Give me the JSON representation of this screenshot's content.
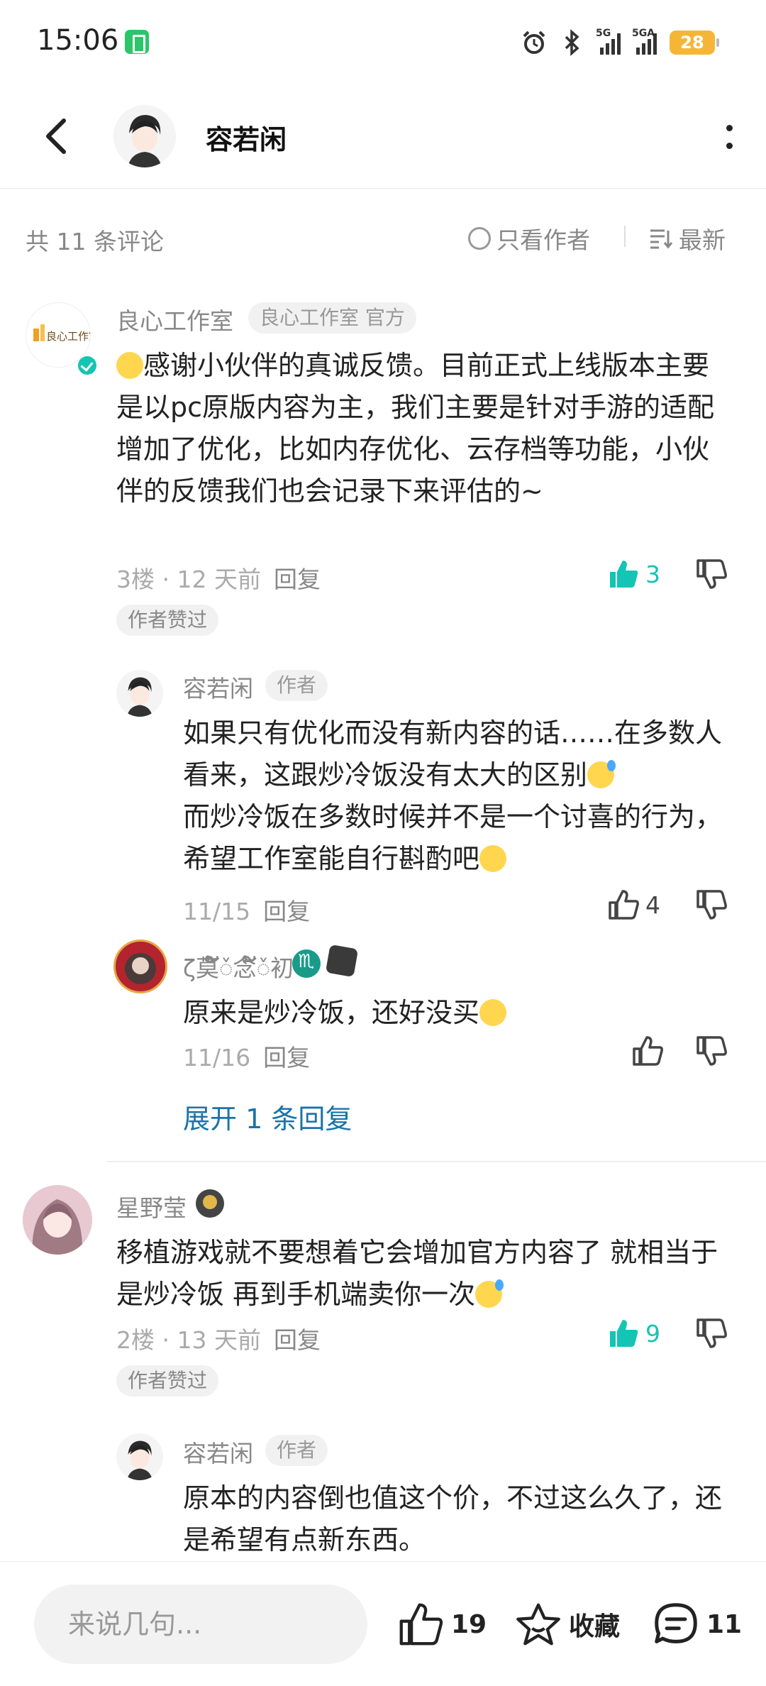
{
  "status_bar": {
    "time": "15:06",
    "battery": "28",
    "signal1_label": "5G",
    "signal2_label": "5GA"
  },
  "header": {
    "title": "容若闲"
  },
  "filter": {
    "count_text": "共 11 条评论",
    "author_only_label": "只看作者",
    "sort_label": "最新"
  },
  "comments": [
    {
      "username": "良心工作室",
      "tag": "良心工作室 官方",
      "avatar_text": "良心工作室",
      "text": "感谢小伙伴的真诚反馈。目前正式上线版本主要是以pc原版内容为主，我们主要是针对手游的适配增加了优化，比如内存优化、云存档等功能，小伙伴的反馈我们也会记录下来评估的~",
      "meta": "3楼 · 12 天前",
      "reply_label": "回复",
      "likes": "3",
      "liked_badge": "作者赞过",
      "replies": [
        {
          "username": "容若闲",
          "tag": "作者",
          "text_1": "如果只有优化而没有新内容的话……在多数人看来，这跟炒冷饭没有太大的区别",
          "text_2": "而炒冷饭在多数时候并不是一个讨喜的行为，希望工作室能自行斟酌吧",
          "meta": "11/15",
          "reply_label": "回复",
          "likes": "4"
        },
        {
          "username": "ζ莫້້໌ᮨ念້້໌ᮨ初",
          "text": "原来是炒冷饭，还好没买",
          "meta": "11/16",
          "reply_label": "回复"
        }
      ],
      "expand_label": "展开 1 条回复"
    },
    {
      "username": "星野莹",
      "text": "移植游戏就不要想着它会增加官方内容了 就相当于是炒冷饭 再到手机端卖你一次",
      "meta": "2楼 · 13 天前",
      "reply_label": "回复",
      "likes": "9",
      "liked_badge": "作者赞过",
      "replies": [
        {
          "username": "容若闲",
          "tag": "作者",
          "text": "原本的内容倒也值这个价，不过这么久了，还是希望有点新东西。"
        }
      ]
    }
  ],
  "bottom_bar": {
    "input_placeholder": "来说几句...",
    "likes": "19",
    "favorite_label": "收藏",
    "comments": "11"
  },
  "colors": {
    "accent": "#14c4b4",
    "link": "#1a73a8"
  }
}
